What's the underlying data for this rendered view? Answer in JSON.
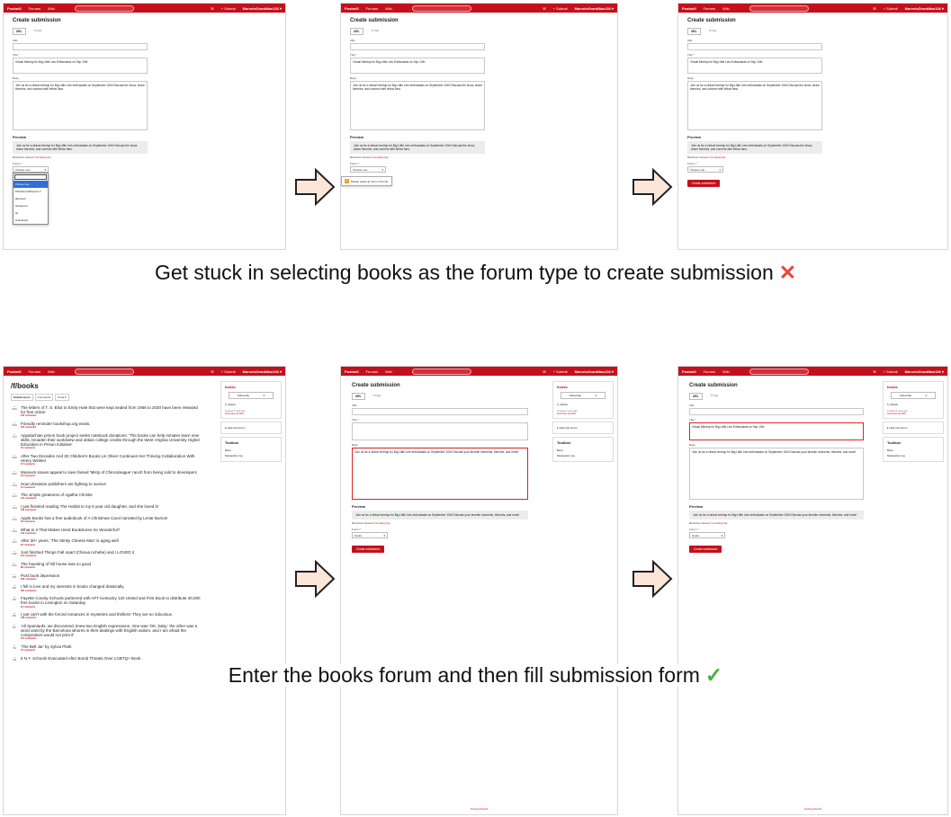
{
  "colors": {
    "brand": "#c4101c",
    "panel_border": "#d6d6d6",
    "arrow_fill": "#fbe6d8",
    "cross": "#e8473a",
    "check": "#46b043"
  },
  "nav": {
    "brand": "Postmill",
    "forums": "Forums",
    "wiki": "Wiki",
    "submit": "+ Submit",
    "user": "MarvelsGrantMan136 ▾"
  },
  "form": {
    "title": "Create submission",
    "tab_url": "URL",
    "tab_image": "Image",
    "label_url": "URL",
    "label_title": "Title *",
    "label_body": "Body",
    "title_value": "Virtual Meetup for Big Little Lies Enthusiasts on Sep 10th",
    "body_value": "Join us for a virtual meetup for Big Little Lies enthusiasts on September 10th! Discuss the show, share theories, and connect with fellow fans.",
    "body_value_books": "Join us for a virtual meetup for Big Little Lies enthusiasts on September 10th! Discuss your favorite moments, theories, and more!",
    "preview_heading": "Preview",
    "markdown_prefix": "Markdown allowed.",
    "markdown_link": "Formatting help",
    "label_forum": "Forum *",
    "forum_placeholder": "Choose one...",
    "forum_books": "books",
    "create_button": "Create submission",
    "validation_tip": "Please select an item in the list.",
    "dropdown_options": [
      "Choose one...",
      "PlantsForCatParents",
      "allentown",
      "arlingtonva",
      "art",
      "audiobooks"
    ]
  },
  "sidebar": {
    "forum_name": "books",
    "subscribe": "Subscribe",
    "subscriber_count": "0",
    "owner": "f/_Sahuk",
    "created": "Created 5 years ago",
    "rss": "Subscribe via RSS",
    "hide": "▸ Hide this forum",
    "toolbox": "Toolbox",
    "bans": "Bans",
    "modlog": "Moderation log"
  },
  "footer": {
    "running": "Running Postmill"
  },
  "captions": {
    "fail": "Get stuck in selecting books as the forum type to create submission",
    "fail_mark": "✕",
    "success": "Enter the books forum and then fill submission form",
    "success_mark": "✓"
  },
  "forum_page": {
    "heading": "/f/books",
    "tabs": [
      "Submissions",
      "Comments",
      "▾ Hot ▾"
    ],
    "posts": [
      {
        "votes": "3591",
        "title": "The letters of T. S. Eliot to Emily Hale that were kept sealed from 1956 to 2020 have been released for free online",
        "comments": "133 comments"
      },
      {
        "votes": "3069",
        "title": "Friendly reminder bookshop.org exists.",
        "comments": "105 comments"
      },
      {
        "votes": "1714",
        "title": "Appalachian prison book project seeks notebook donations: 'The books can help inmates learn new skills, broaden their worldview and obtain college credits through the West Virginia University Higher Education in Prison Initiative'",
        "comments": "45 comments"
      },
      {
        "votes": "1600",
        "title": "After Two Decades And 30 Children's Books Lin Oliver Continues Her Thriving Collaboration With Henry Winkler",
        "comments": "27 comments"
      },
      {
        "votes": "1520",
        "title": "Museum issues appeal to save famed 'Misty of Chincoteague' ranch from being sold to developers",
        "comments": "43 comments"
      },
      {
        "votes": "1434",
        "title": "How Ukrainian publishers are fighting to survive",
        "comments": "21 comments"
      },
      {
        "votes": "1423",
        "title": "The simple greatness of Agatha Christie",
        "comments": "191 comments"
      },
      {
        "votes": "1423",
        "title": "I just finished reading The Hobbit to my 6 year old daughter, and she loved it!",
        "comments": "109 comments"
      },
      {
        "votes": "1370",
        "title": "Apple Books has a free audiobook of A Christmas Carol narrated by LeVar Burton!",
        "comments": "59 comments"
      },
      {
        "votes": "1344",
        "title": "What Is It That Makes Used Bookstores So Wonderful?",
        "comments": "144 comments"
      },
      {
        "votes": "1321",
        "title": "After 30+ years, 'The Stinky Cheese Man' is aging well",
        "comments": "87 comments"
      },
      {
        "votes": "1180",
        "title": "Just finished Things Fall Apart (Chinua Achebe) and I LOVED it",
        "comments": "112 comments"
      },
      {
        "votes": "1011",
        "title": "The haunting of hill house was so good",
        "comments": "88 comments"
      },
      {
        "votes": "965",
        "title": "Post book depression",
        "comments": "183 comments"
      },
      {
        "votes": "926",
        "title": "I fell in love and my interests in books changed drastically.",
        "comments": "505 comments"
      },
      {
        "votes": "906",
        "title": "Fayette County Schools partnered with AFT Kentucky 120 United and First Book to distribute 40,000 free books in Lexington on Saturday",
        "comments": "22 comments"
      },
      {
        "votes": "866",
        "title": "I just can't with the forced romances in mysteries and thrillers! They are so ridiculous",
        "comments": "120 comments"
      },
      {
        "votes": "847",
        "title": "'All Spaniards, we discovered, knew two English expressions. One was 'OK, baby,' the other was a word used by the Barcelona whores in their dealings with English sailors, and I am afraid the compositors would not print it'",
        "comments": "115 comments"
      },
      {
        "votes": "762",
        "title": "'The Bell Jar' by Sylvia Plath",
        "comments": "76 comments"
      },
      {
        "votes": "738",
        "title": "5 N.Y. Schools Evacuated After Bomb Threats Over LGBTQ+ Book",
        "comments": ""
      }
    ]
  }
}
